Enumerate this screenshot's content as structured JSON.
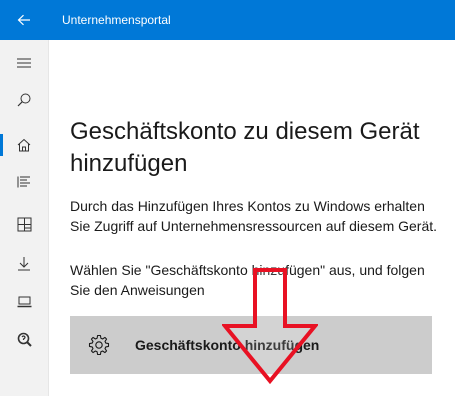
{
  "titlebar": {
    "title": "Unternehmensportal",
    "back_icon": "back-arrow-icon",
    "color": "#0078d7"
  },
  "sidebar": {
    "items": [
      {
        "icon": "hamburger-menu-icon",
        "selected": false
      },
      {
        "icon": "search-icon",
        "selected": false
      },
      {
        "icon": "home-icon",
        "selected": true
      },
      {
        "icon": "list-icon",
        "selected": false
      },
      {
        "icon": "apps-grid-icon",
        "selected": false
      },
      {
        "icon": "download-icon",
        "selected": false
      },
      {
        "icon": "device-icon",
        "selected": false
      },
      {
        "icon": "help-search-icon",
        "selected": false
      }
    ],
    "accent": "#0078d7"
  },
  "main": {
    "heading": "Geschäftskonto zu diesem Gerät hinzufügen",
    "paragraph1": "Durch das Hinzufügen Ihres Kontos zu Windows erhalten Sie Zugriff auf Unternehmensressourcen auf diesem Gerät.",
    "paragraph2": "Wählen Sie \"Geschäftskonto hinzufügen\" aus, und folgen Sie den Anweisungen",
    "button_label": "Geschäftskonto hinzufügen",
    "button_icon": "gear-icon",
    "annotation_icon": "red-arrow-down-icon",
    "annotation_color": "#e81123"
  }
}
